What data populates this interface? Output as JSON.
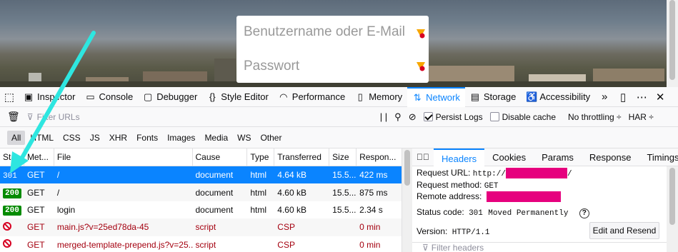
{
  "webpage": {
    "username_placeholder": "Benutzername oder E-Mail",
    "password_placeholder": "Passwort"
  },
  "devtools_tabs": [
    {
      "label": "Inspector",
      "icon": "inspector-icon"
    },
    {
      "label": "Console",
      "icon": "console-icon"
    },
    {
      "label": "Debugger",
      "icon": "debugger-icon"
    },
    {
      "label": "Style Editor",
      "icon": "style-editor-icon"
    },
    {
      "label": "Performance",
      "icon": "performance-icon"
    },
    {
      "label": "Memory",
      "icon": "memory-icon"
    },
    {
      "label": "Network",
      "icon": "network-icon",
      "active": true
    },
    {
      "label": "Storage",
      "icon": "storage-icon"
    },
    {
      "label": "Accessibility",
      "icon": "accessibility-icon"
    }
  ],
  "toolbar": {
    "filter_placeholder": "Filter URLs",
    "persist_logs": "Persist Logs",
    "disable_cache": "Disable cache",
    "throttling": "No throttling ÷",
    "har": "HAR ÷"
  },
  "filters": [
    "All",
    "HTML",
    "CSS",
    "JS",
    "XHR",
    "Fonts",
    "Images",
    "Media",
    "WS",
    "Other"
  ],
  "table": {
    "headers": [
      "Stat...",
      "Met...",
      "File",
      "Cause",
      "Type",
      "Transferred",
      "Size",
      "Respon..."
    ],
    "rows": [
      {
        "status": "301",
        "method": "GET",
        "file": "/",
        "cause": "document",
        "type": "html",
        "transferred": "4.64 kB",
        "size": "15.5...",
        "response": "422 ms",
        "kind": "selected"
      },
      {
        "status": "200",
        "method": "GET",
        "file": "/",
        "cause": "document",
        "type": "html",
        "transferred": "4.60 kB",
        "size": "15.5...",
        "response": "875 ms",
        "kind": "ok"
      },
      {
        "status": "200",
        "method": "GET",
        "file": "login",
        "cause": "document",
        "type": "html",
        "transferred": "4.60 kB",
        "size": "15.5...",
        "response": "2.34 s",
        "kind": "ok"
      },
      {
        "status": "",
        "method": "GET",
        "file": "main.js?v=25ed78da-45",
        "cause": "script",
        "type": "",
        "transferred": "CSP",
        "size": "",
        "response": "0 min",
        "kind": "blocked"
      },
      {
        "status": "",
        "method": "GET",
        "file": "merged-template-prepend.js?v=25...",
        "cause": "script",
        "type": "",
        "transferred": "CSP",
        "size": "",
        "response": "0 min",
        "kind": "blocked"
      }
    ]
  },
  "details": {
    "tabs": [
      "Headers",
      "Cookies",
      "Params",
      "Response",
      "Timings"
    ],
    "request_url_label": "Request URL:",
    "request_url_prefix": "http://",
    "request_url_suffix": "/",
    "request_method_label": "Request method:",
    "request_method": "GET",
    "remote_address_label": "Remote address:",
    "status_code_label": "Status code:",
    "status_code": "301",
    "status_text": "Moved Permanently",
    "version_label": "Version:",
    "version": "HTTP/1.1",
    "edit_resend": "Edit and Resend",
    "filter_headers": "Filter headers"
  },
  "colors": {
    "accent": "#0a84ff",
    "ok_badge": "#058b00",
    "blocked": "#d70022",
    "redaction": "#e6007e",
    "arrow": "#2ee6e0"
  }
}
